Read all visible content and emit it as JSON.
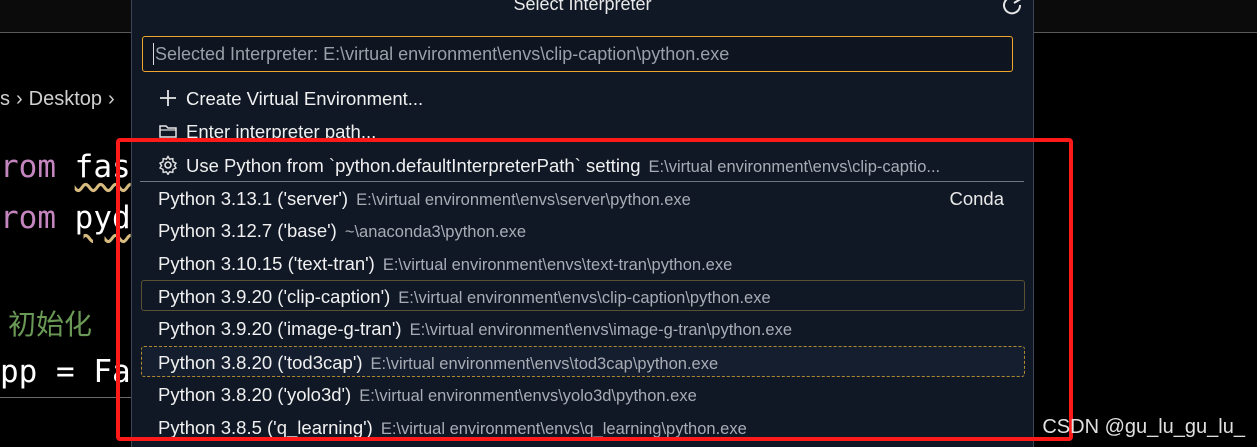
{
  "quick_pick": {
    "title": "Select Interpreter",
    "input_value": "Selected Interpreter: E:\\virtual environment\\envs\\clip-caption\\python.exe",
    "actions": [
      {
        "label": "Create Virtual Environment...",
        "icon": "plus-icon"
      },
      {
        "label": "Enter interpreter path...",
        "icon": "folder-icon"
      },
      {
        "label": "Use Python from `python.defaultInterpreterPath` setting",
        "detail": "E:\\virtual environment\\envs\\clip-captio...",
        "icon": "gear-icon"
      }
    ],
    "interpreters": [
      {
        "label": "Python 3.13.1 ('server')",
        "path": "E:\\virtual environment\\envs\\server\\python.exe",
        "badge": "Conda"
      },
      {
        "label": "Python 3.12.7 ('base')",
        "path": "~\\anaconda3\\python.exe"
      },
      {
        "label": "Python 3.10.15 ('text-tran')",
        "path": "E:\\virtual environment\\envs\\text-tran\\python.exe"
      },
      {
        "label": "Python 3.9.20 ('clip-caption')",
        "path": "E:\\virtual environment\\envs\\clip-caption\\python.exe"
      },
      {
        "label": "Python 3.9.20 ('image-g-tran')",
        "path": "E:\\virtual environment\\envs\\image-g-tran\\python.exe"
      },
      {
        "label": "Python 3.8.20 ('tod3cap')",
        "path": "E:\\virtual environment\\envs\\tod3cap\\python.exe"
      },
      {
        "label": "Python 3.8.20 ('yolo3d')",
        "path": "E:\\virtual environment\\envs\\yolo3d\\python.exe"
      },
      {
        "label": "Python 3.8.5 ('q_learning')",
        "path": "E:\\virtual environment\\envs\\q_learning\\python.exe"
      }
    ]
  },
  "editor": {
    "breadcrumb": {
      "before": "s",
      "folder": "Desktop"
    },
    "lines": [
      {
        "keyword": "rom",
        "module": "fas"
      },
      {
        "keyword": "rom",
        "module": "pyd"
      },
      {
        "comment": "初始化"
      },
      {
        "code": "pp = Fa"
      }
    ]
  },
  "watermark": "CSDN @gu_lu_gu_lu_",
  "colors": {
    "accent_border": "#f0a52d",
    "annotation": "#ff1a1a",
    "panel_bg": "#101826"
  }
}
